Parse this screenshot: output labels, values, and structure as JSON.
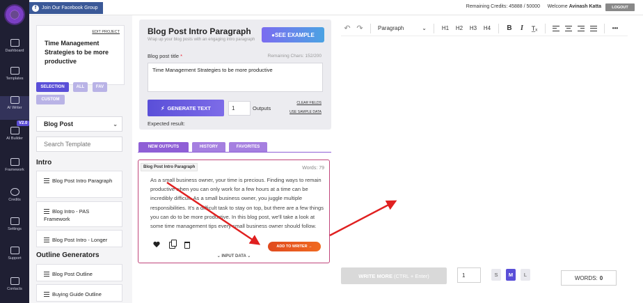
{
  "topbar": {
    "facebook_label": "Join Our Facebook Group",
    "facebook_icon": "facebook-icon",
    "credits": "Remaining Credits: 45888 / 50000",
    "welcome": "Welcome",
    "user_name": "Avinash Katta",
    "logout": "LOGOUT"
  },
  "nav": {
    "logo": "brain-logo-icon",
    "items": [
      {
        "label": "Dashboard",
        "icon": "home-icon"
      },
      {
        "label": "Templates",
        "icon": "grid-icon"
      },
      {
        "label": "AI Writer",
        "icon": "pen-icon"
      },
      {
        "label": "AI Builder",
        "icon": "blocks-icon"
      },
      {
        "label": "Framework",
        "icon": "hierarchy-icon"
      },
      {
        "label": "Credits",
        "icon": "coin-icon"
      },
      {
        "label": "Settings",
        "icon": "tools-icon"
      },
      {
        "label": "Support",
        "icon": "help-icon"
      },
      {
        "label": "Contacts",
        "icon": "mail-icon"
      }
    ],
    "version_badge": "V2.0"
  },
  "sidebar": {
    "edit_project": "EDIT PROJECT",
    "project_title": "Time Management Strategies to be more productive",
    "filters": [
      "SELECTION",
      "ALL",
      "FAV",
      "CUSTOM"
    ],
    "category": "Blog Post",
    "search_placeholder": "Search Template",
    "section_intro": "Intro",
    "intro_items": [
      "Blog Post Intro Paragraph",
      "Blog Intro - PAS Framework",
      "Blog Post Intro - Longer"
    ],
    "section_outline": "Outline Generators",
    "outline_items": [
      "Blog Post Outline",
      "Buying Guide Outline"
    ]
  },
  "form": {
    "title": "Blog Post Intro Paragraph",
    "subtitle": "Wrap up your blog posts with an engaging intro paragraph",
    "see_example": "SEE EXAMPLE",
    "field_label": "Blog post title",
    "required_mark": "*",
    "remaining_chars": "Remaining Chars: 152/200",
    "field_value": "Time Management Strategies to be more productive",
    "generate": "GENERATE TEXT",
    "outputs_value": "1",
    "outputs_label": "Outputs",
    "clear_fields": "CLEAR FIELDS",
    "sample_data": "USE SAMPLE DATA",
    "expected": "Expected result:"
  },
  "tabs": [
    "NEW OUTPUTS",
    "HISTORY",
    "FAVORITES"
  ],
  "output": {
    "tag": "Blog Post Intro Paragraph",
    "words": "Words: 79",
    "text": "As a small business owner, your time is precious. Finding ways to remain productive when you can only work for a few hours at a time can be incredibly difficult. As a small business owner, you juggle multiple responsibilities. It's a difficult task to stay on top, but there are a few things you can do to be more productive. In this blog post, we'll take a look at some time management tips every small business owner should follow.",
    "add_to_writer": "ADD TO WRITER →",
    "input_data": "⌄ INPUT DATA ⌄"
  },
  "editor": {
    "paragraph": "Paragraph",
    "headings": [
      "H1",
      "H2",
      "H3",
      "H4"
    ],
    "bold": "B",
    "italic": "I",
    "clear_format": "T̲ₓ",
    "more": "•••",
    "undo": "↶",
    "redo": "↷",
    "write_more": "WRITE MORE",
    "shortcut": "(CTRL + Enter)",
    "count": "1",
    "sizes": [
      "S",
      "M",
      "L"
    ],
    "active_size": "M",
    "words_label": "WORDS:",
    "words_value": "0"
  },
  "colors": {
    "nav_bg": "#1f1f33",
    "accent_purple": "#8f5fd6",
    "accent_orange": "#e04a1e",
    "facebook": "#3b5998",
    "arrow_red": "#e02020"
  }
}
